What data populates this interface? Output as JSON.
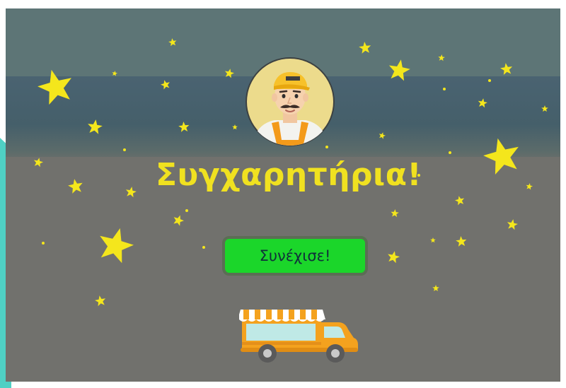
{
  "screen": {
    "headline": "Συγχαρητήρια!",
    "continue_button_label": "Συνέχισε!"
  },
  "colors": {
    "star": "#f4e61c",
    "headline": "#f0e120",
    "button": "#1bd62a",
    "teal_edge": "#4fd0c4"
  },
  "icons": {
    "avatar": "vendor-avatar-icon",
    "vehicle": "food-truck-icon",
    "decoration": "star-icon"
  }
}
